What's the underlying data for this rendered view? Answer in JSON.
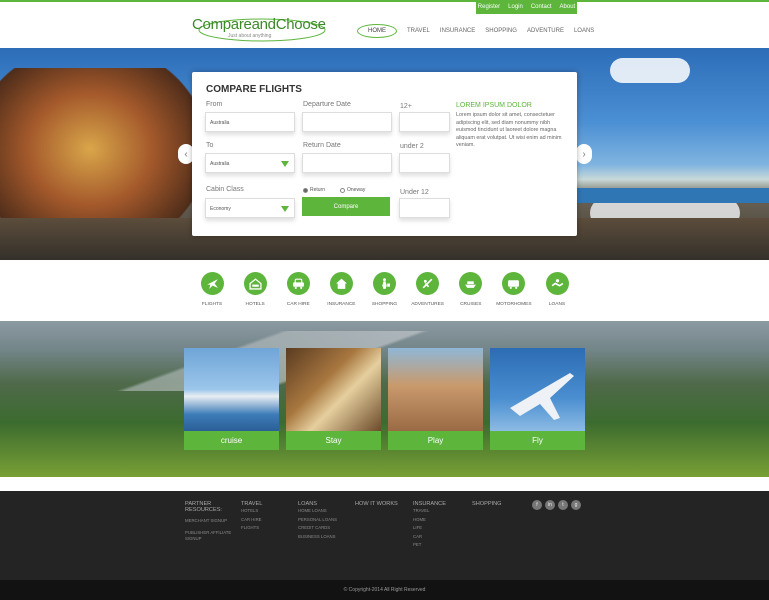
{
  "toplinks": [
    "Register",
    "Login",
    "Contact",
    "About"
  ],
  "logo": {
    "name": "CompareandChoose",
    "tagline": "Just about anything"
  },
  "nav": [
    "HOME",
    "TRAVEL",
    "INSURANCE",
    "SHOPPING",
    "ADVENTURE",
    "LOANS"
  ],
  "search": {
    "title": "COMPARE FLIGHTS",
    "from_label": "From",
    "from_value": "Australia",
    "to_label": "To",
    "to_value": "Australia",
    "cabin_label": "Cabin Class",
    "cabin_value": "Economy",
    "departure_label": "Departure Date",
    "return_label": "Return Date",
    "trip_return": "Return",
    "trip_oneway": "Oneway",
    "compare_label": "Compare",
    "adults_label": "12+",
    "children_label": "under 2",
    "infants_label": "Under 12",
    "side_title": "LOREM IPSUM DOLOR",
    "side_body": "Lorem ipsum dolor sit amet, consectetuer adipiscing elit, sed diam nonummy nibh euismod tincidunt ut laoreet dolore magna aliquam erat volutpat. Ut wisi enim ad minim veniam."
  },
  "categories": [
    {
      "label": "FLIGHTS",
      "icon": "plane-icon"
    },
    {
      "label": "HOTELS",
      "icon": "hotel-icon"
    },
    {
      "label": "CAR HIRE",
      "icon": "car-icon"
    },
    {
      "label": "INSURANCE",
      "icon": "house-icon"
    },
    {
      "label": "SHOPPING",
      "icon": "shopping-icon"
    },
    {
      "label": "ADVENTURES",
      "icon": "adventure-icon"
    },
    {
      "label": "CRUISES",
      "icon": "ship-icon"
    },
    {
      "label": "MOTORHOMES",
      "icon": "motorhome-icon"
    },
    {
      "label": "LOANS",
      "icon": "loan-icon"
    }
  ],
  "cards": [
    "cruise",
    "Stay",
    "Play",
    "Fly"
  ],
  "footer": {
    "partner": {
      "title": "PARTNER RESOURCES:",
      "items": [
        "MERCHANT SIGNUP",
        "PUBLISHER AFFILIATE SIGNUP"
      ]
    },
    "travel": {
      "title": "TRAVEL",
      "items": [
        "HOTELS",
        "CAR HIRE",
        "FLIGHTS"
      ]
    },
    "loans": {
      "title": "LOANS",
      "items": [
        "HOME LOANS",
        "PERSONAL LOANS",
        "CREDIT CARDS",
        "BUSINESS LOANS"
      ]
    },
    "how": {
      "title": "HOW IT WORKS"
    },
    "insurance": {
      "title": "INSURANCE",
      "items": [
        "TRAVEL",
        "HOME",
        "LIFE",
        "CAR",
        "PET"
      ]
    },
    "shopping": {
      "title": "SHOPPING"
    },
    "social": [
      "f",
      "in",
      "t",
      "g"
    ],
    "copyright": "© Copyright-2014 All Right Reserved"
  }
}
